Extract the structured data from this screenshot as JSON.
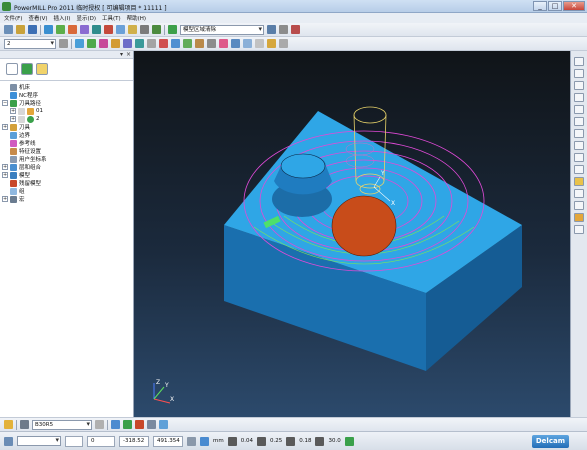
{
  "window": {
    "title": "PowerMILL Pro 2011 临时授权  [ 可编辑项目 * 11111 ]",
    "buttons": [
      "_",
      "□",
      "✕"
    ]
  },
  "menu": [
    "文件(F)",
    "查看(V)",
    "插入(I)",
    "显示(D)",
    "工具(T)",
    "帮助(H)"
  ],
  "toolbar1": {
    "boundary_combo": "模型区域清除"
  },
  "toolbar2": {
    "toolpath_combo": "2"
  },
  "tree": [
    {
      "label": "机床",
      "level": 0,
      "expand": ""
    },
    {
      "label": "NC程序",
      "level": 0,
      "expand": ""
    },
    {
      "label": "刀具路径",
      "level": 0,
      "expand": "−"
    },
    {
      "label": "01",
      "level": 1,
      "expand": "+"
    },
    {
      "label": "2",
      "level": 1,
      "expand": "+"
    },
    {
      "label": "刀具",
      "level": 0,
      "expand": "+"
    },
    {
      "label": "边界",
      "level": 0,
      "expand": ""
    },
    {
      "label": "参考线",
      "level": 0,
      "expand": ""
    },
    {
      "label": "特征设置",
      "level": 0,
      "expand": ""
    },
    {
      "label": "用户坐标系",
      "level": 0,
      "expand": ""
    },
    {
      "label": "层和组合",
      "level": 0,
      "expand": "+"
    },
    {
      "label": "模型",
      "level": 0,
      "expand": "+"
    },
    {
      "label": "残留模型",
      "level": 0,
      "expand": ""
    },
    {
      "label": "组",
      "level": 0,
      "expand": ""
    },
    {
      "label": "宏",
      "level": 0,
      "expand": "+"
    }
  ],
  "bottom_toolbar": {
    "tool_combo": "B30R5"
  },
  "status": {
    "x": "0",
    "y": "-318.52",
    "z": "491.354",
    "unit": "mm",
    "tol1": "0.04",
    "tol2": "0.25",
    "tol3": "0.18",
    "angle": "30.0",
    "brand": "Delcam"
  },
  "axis_labels": {
    "x": "X",
    "y": "Y",
    "z": "Z"
  },
  "colors": {
    "part_top": "#2fa6e6",
    "part_side": "#1a6fae",
    "pocket": "#c84c1a",
    "toolpath": "#e04ad8",
    "tool": "#e8d36a"
  }
}
